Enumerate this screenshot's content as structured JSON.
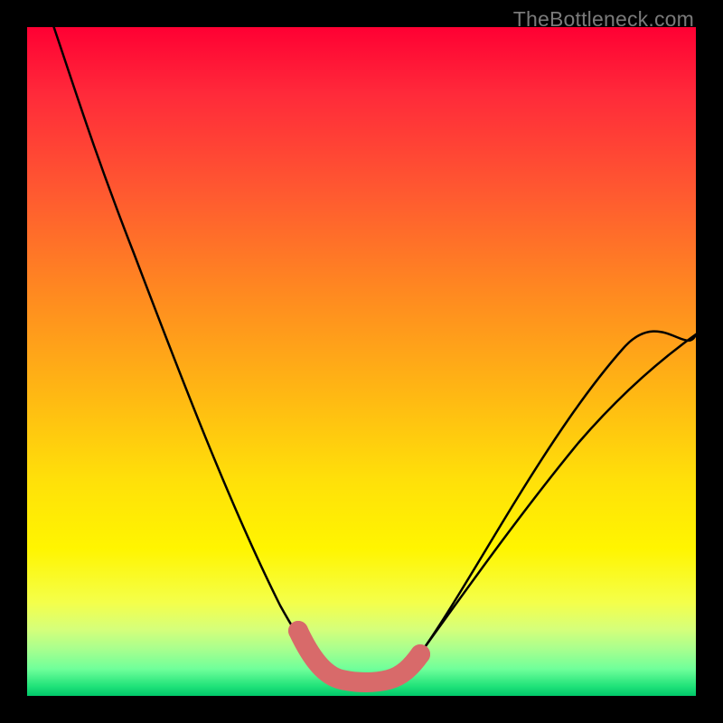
{
  "watermark": "TheBottleneck.com",
  "colors": {
    "frame_bg": "#000000",
    "gradient_top": "#ff0033",
    "gradient_mid": "#ffe109",
    "gradient_bottom": "#00c86a",
    "curve_stroke": "#000000",
    "salient_stroke": "#d86a6a"
  },
  "chart_data": {
    "type": "line",
    "title": "",
    "xlabel": "",
    "ylabel": "",
    "xlim": [
      0,
      100
    ],
    "ylim": [
      0,
      100
    ],
    "series": [
      {
        "name": "bottleneck-curve",
        "x": [
          4,
          8,
          12,
          16,
          20,
          24,
          28,
          32,
          35,
          38,
          40,
          42,
          44,
          46,
          49,
          52,
          55,
          58,
          62,
          66,
          70,
          74,
          78,
          82,
          86,
          90,
          94,
          98,
          100
        ],
        "y": [
          100,
          88,
          77,
          66,
          56,
          46,
          37,
          28,
          21,
          15,
          11,
          8,
          5.5,
          3.5,
          2.3,
          2.2,
          2.4,
          3.8,
          7,
          12,
          17,
          22,
          27,
          32,
          37,
          42,
          47,
          52,
          54
        ]
      }
    ],
    "salient_region": {
      "name": "optimal-zone",
      "x": [
        40,
        42,
        44,
        46,
        49,
        52,
        55,
        58
      ],
      "y": [
        11,
        8,
        5.5,
        3.5,
        2.3,
        2.2,
        2.4,
        3.8
      ]
    },
    "notes": "Axes unlabeled; values estimated from pixel positions. y=0 corresponds to bottom (green). Background gradient encodes severity: red=high, green=low."
  }
}
